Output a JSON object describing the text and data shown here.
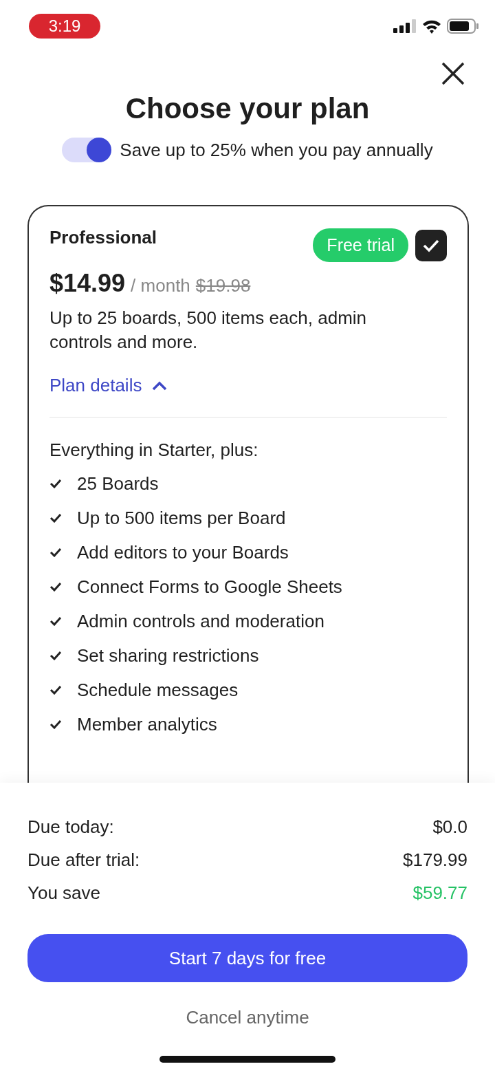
{
  "status_bar": {
    "time": "3:19"
  },
  "title": "Choose your plan",
  "billing_toggle": {
    "on": true,
    "label": "Save up to 25% when you pay annually"
  },
  "plan": {
    "name": "Professional",
    "badge": "Free trial",
    "selected": true,
    "price": "$14.99",
    "period": "/ month",
    "old_price": "$19.98",
    "description": "Up to 25 boards, 500 items each, admin controls and more.",
    "details_link": "Plan details",
    "expanded": true,
    "features_intro": "Everything in Starter, plus:",
    "features": [
      "25 Boards",
      "Up to 500 items per Board",
      "Add editors to your Boards",
      "Connect Forms to Google Sheets",
      "Admin controls and moderation",
      "Set sharing restrictions",
      "Schedule messages",
      "Member analytics"
    ]
  },
  "summary": [
    {
      "label": "Due today:",
      "value": "$0.0",
      "kind": "amount"
    },
    {
      "label": "Due after trial:",
      "value": "$179.99",
      "kind": "amount"
    },
    {
      "label": "You save",
      "value": "$59.77",
      "kind": "saving"
    }
  ],
  "cta_button": "Start 7 days for free",
  "footnote": "Cancel anytime"
}
